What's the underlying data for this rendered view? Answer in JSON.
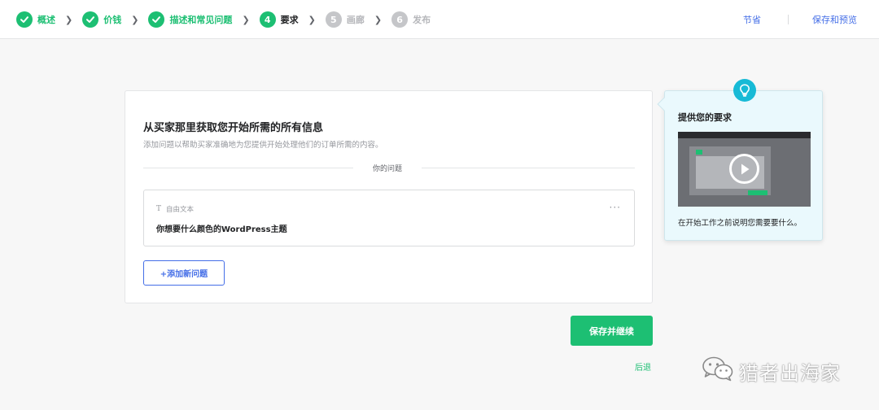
{
  "steps": [
    {
      "num": "1",
      "label": "概述",
      "state": "done"
    },
    {
      "num": "2",
      "label": "价钱",
      "state": "done"
    },
    {
      "num": "3",
      "label": "描述和常见问题",
      "state": "done"
    },
    {
      "num": "4",
      "label": "要求",
      "state": "active"
    },
    {
      "num": "5",
      "label": "画廊",
      "state": "todo"
    },
    {
      "num": "6",
      "label": "发布",
      "state": "todo"
    }
  ],
  "topbar": {
    "save_label": "节省",
    "save_preview_label": "保存和预览"
  },
  "card": {
    "title": "从买家那里获取您开始所需的所有信息",
    "subtitle": "添加问题以帮助买家准确地为您提供开始处理他们的订单所需的内容。",
    "section_label": "你的问题",
    "question": {
      "type_icon": "T",
      "type_label": "自由文本",
      "text": "你想要什么颜色的WordPress主题",
      "more_icon": "···"
    },
    "add_button": "+添加新问题"
  },
  "actions": {
    "save_continue": "保存并继续",
    "back": "后退"
  },
  "tip": {
    "title": "提供您的要求",
    "description": "在开始工作之前说明您需要要什么。"
  },
  "watermark": {
    "text": "猎者出海家"
  },
  "colors": {
    "accent_green": "#1dbf73",
    "link_blue": "#446ee7",
    "tip_bg": "#eaf9fd",
    "bulb_cyan": "#17bad6"
  },
  "icons": {
    "step_done": "check-icon",
    "step_separator": "chevron-right-icon",
    "tip_badge": "lightbulb-icon",
    "video": "play-icon",
    "question_menu": "more-options-icon",
    "question_type": "text-type-icon",
    "watermark": "wechat-icon"
  }
}
